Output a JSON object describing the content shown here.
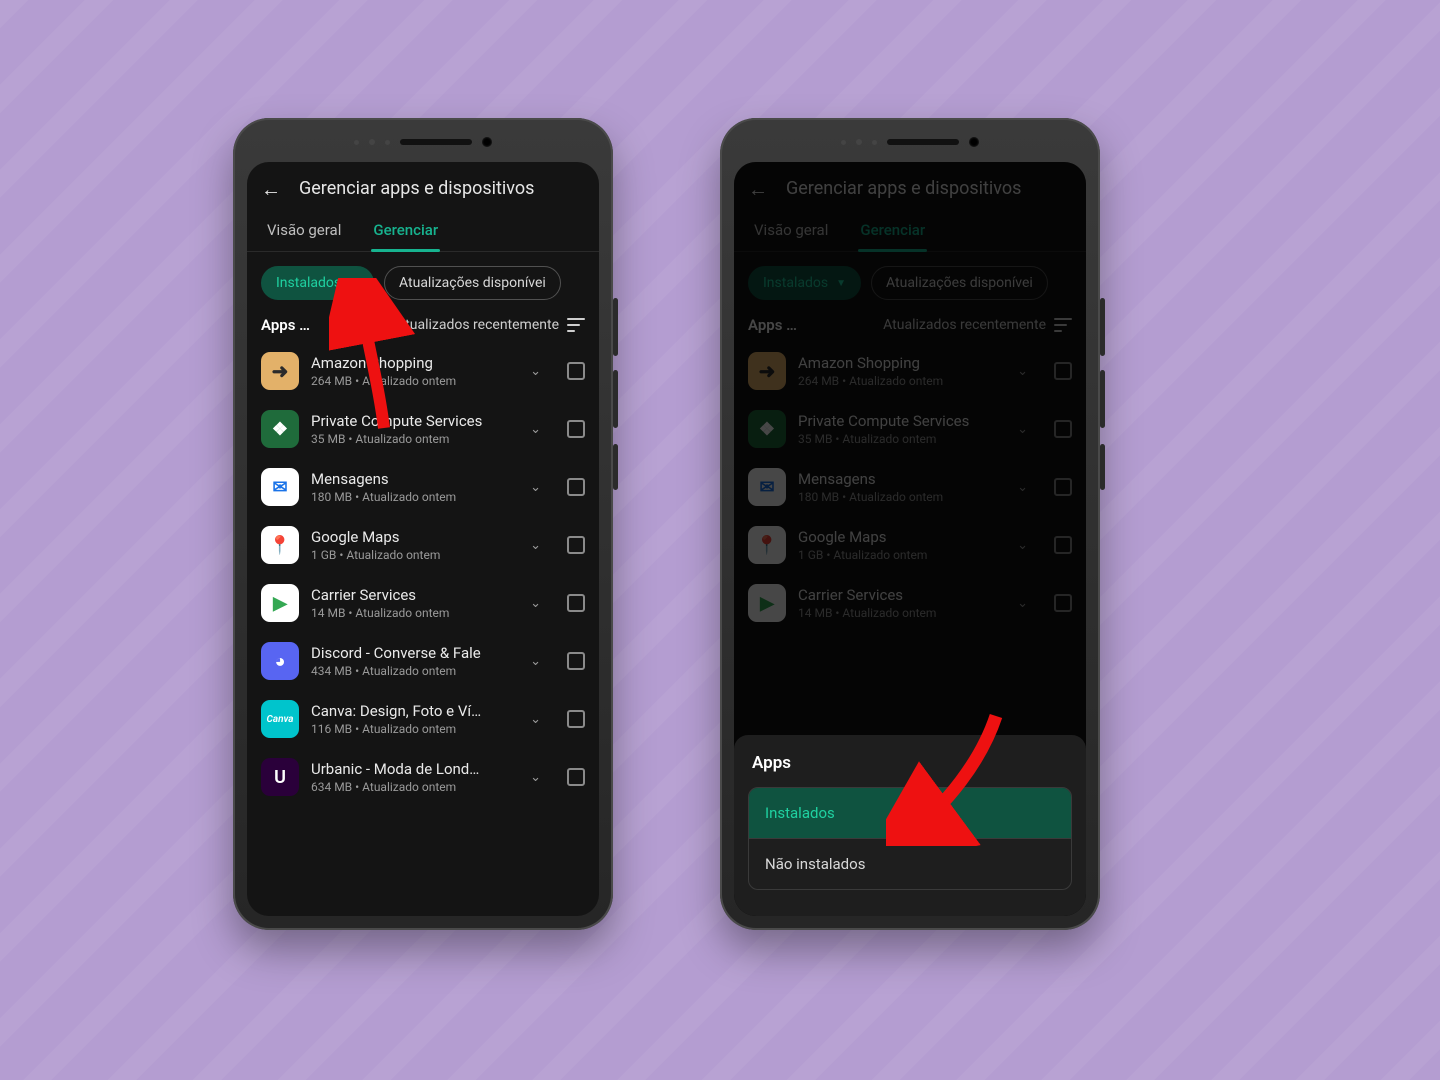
{
  "colors": {
    "accent": "#17b38f",
    "chip_bg": "#0f5340"
  },
  "header": {
    "title": "Gerenciar apps e dispositivos"
  },
  "tabs": {
    "overview": "Visão geral",
    "manage": "Gerenciar"
  },
  "chips": {
    "installed": "Instalados",
    "updates": "Atualizações disponívei"
  },
  "listHeader": {
    "apps_label": "Apps …",
    "sort_label": "Atualizados recentemente"
  },
  "apps": [
    {
      "name": "Amazon Shopping",
      "sub": "264 MB  •  Atualizado ontem",
      "icon": "i-amazon",
      "glyph": "➜"
    },
    {
      "name": "Private Compute Services",
      "sub": "35 MB  •  Atualizado ontem",
      "icon": "i-pcs",
      "glyph": "❖"
    },
    {
      "name": "Mensagens",
      "sub": "180 MB  •  Atualizado ontem",
      "icon": "i-msg",
      "glyph": "✉"
    },
    {
      "name": "Google Maps",
      "sub": "1 GB  •  Atualizado ontem",
      "icon": "i-maps",
      "glyph": "📍"
    },
    {
      "name": "Carrier Services",
      "sub": "14 MB  •  Atualizado ontem",
      "icon": "i-carrier",
      "glyph": "▶"
    },
    {
      "name": "Discord - Converse & Fale",
      "sub": "434 MB  •  Atualizado ontem",
      "icon": "i-discord",
      "glyph": "◕"
    },
    {
      "name": "Canva: Design, Foto e Ví…",
      "sub": "116 MB  •  Atualizado ontem",
      "icon": "i-canva",
      "glyph": "Canva"
    },
    {
      "name": "Urbanic - Moda de Lond…",
      "sub": "634 MB  •  Atualizado ontem",
      "icon": "i-urbanic",
      "glyph": ""
    }
  ],
  "sheet": {
    "title": "Apps",
    "opt_installed": "Instalados",
    "opt_not_installed": "Não instalados"
  }
}
